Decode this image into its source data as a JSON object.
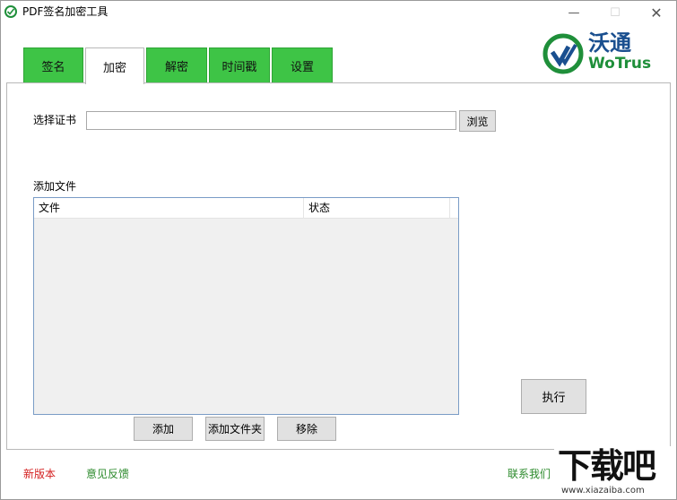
{
  "window": {
    "title": "PDF签名加密工具",
    "controls": {
      "minimize": "—",
      "maximize": "☐",
      "close": "✕"
    }
  },
  "logo": {
    "cn": "沃通",
    "en": "WoTrus"
  },
  "tabs": [
    {
      "label": "签名",
      "active": false
    },
    {
      "label": "加密",
      "active": true
    },
    {
      "label": "解密",
      "active": false
    },
    {
      "label": "时间戳",
      "active": false
    },
    {
      "label": "设置",
      "active": false
    }
  ],
  "encrypt": {
    "cert_label": "选择证书",
    "cert_value": "",
    "browse_label": "浏览",
    "add_file_label": "添加文件",
    "columns": [
      "文件",
      "状态"
    ],
    "rows": [],
    "add_button": "添加",
    "add_folder_button": "添加文件夹",
    "remove_button": "移除",
    "execute_button": "执行"
  },
  "footer": {
    "new_version": "新版本",
    "feedback": "意见反馈",
    "contact": "联系我们"
  },
  "watermark": {
    "text": "下载吧",
    "url": "www.xiazaiba.com"
  },
  "colors": {
    "tab_green": "#3ec446",
    "logo_green": "#1f8f3a",
    "logo_blue": "#1a4f8f",
    "link_red": "#d42020",
    "link_green": "#2b8a2b"
  }
}
